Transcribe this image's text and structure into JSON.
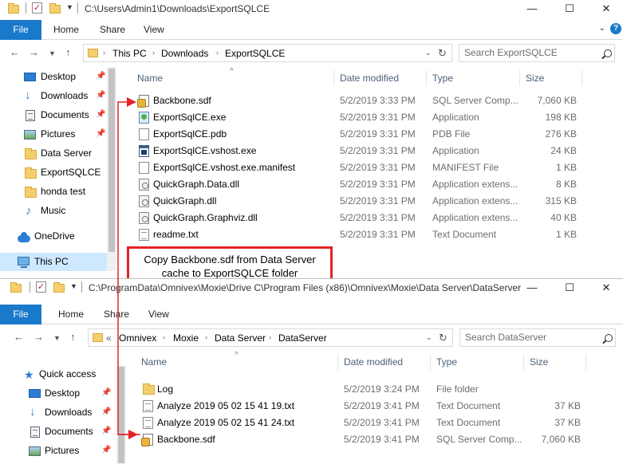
{
  "top_window": {
    "title": "C:\\Users\\Admin1\\Downloads\\ExportSQLCE",
    "ribbon_tabs": [
      "File",
      "Home",
      "Share",
      "View"
    ],
    "breadcrumb": [
      "This PC",
      "Downloads",
      "ExportSQLCE"
    ],
    "search_placeholder": "Search ExportSQLCE",
    "nav_items": [
      {
        "label": "Desktop",
        "icon": "desktop-icon",
        "pinned": true
      },
      {
        "label": "Downloads",
        "icon": "download-icon",
        "pinned": true
      },
      {
        "label": "Documents",
        "icon": "documents-icon",
        "pinned": true
      },
      {
        "label": "Pictures",
        "icon": "pictures-icon",
        "pinned": true
      },
      {
        "label": "Data Server",
        "icon": "folder-icon",
        "pinned": false
      },
      {
        "label": "ExportSQLCE",
        "icon": "folder-icon",
        "pinned": false
      },
      {
        "label": "honda test",
        "icon": "folder-icon",
        "pinned": false
      },
      {
        "label": "Music",
        "icon": "music-icon",
        "pinned": false
      },
      {
        "label": "OneDrive",
        "icon": "onedrive-icon",
        "pinned": false
      },
      {
        "label": "This PC",
        "icon": "this-pc-icon",
        "pinned": false,
        "selected": true
      }
    ],
    "columns": [
      "Name",
      "Date modified",
      "Type",
      "Size"
    ],
    "files": [
      {
        "name": "Backbone.sdf",
        "date": "5/2/2019 3:33 PM",
        "type": "SQL Server Comp...",
        "size": "7,060 KB",
        "icon": "sdf"
      },
      {
        "name": "ExportSqlCE.exe",
        "date": "5/2/2019 3:31 PM",
        "type": "Application",
        "size": "198 KB",
        "icon": "exe"
      },
      {
        "name": "ExportSqlCE.pdb",
        "date": "5/2/2019 3:31 PM",
        "type": "PDB File",
        "size": "276 KB",
        "icon": "blank"
      },
      {
        "name": "ExportSqlCE.vshost.exe",
        "date": "5/2/2019 3:31 PM",
        "type": "Application",
        "size": "24 KB",
        "icon": "app"
      },
      {
        "name": "ExportSqlCE.vshost.exe.manifest",
        "date": "5/2/2019 3:31 PM",
        "type": "MANIFEST File",
        "size": "1 KB",
        "icon": "blank"
      },
      {
        "name": "QuickGraph.Data.dll",
        "date": "5/2/2019 3:31 PM",
        "type": "Application extens...",
        "size": "8 KB",
        "icon": "dll"
      },
      {
        "name": "QuickGraph.dll",
        "date": "5/2/2019 3:31 PM",
        "type": "Application extens...",
        "size": "315 KB",
        "icon": "dll"
      },
      {
        "name": "QuickGraph.Graphviz.dll",
        "date": "5/2/2019 3:31 PM",
        "type": "Application extens...",
        "size": "40 KB",
        "icon": "dll"
      },
      {
        "name": "readme.txt",
        "date": "5/2/2019 3:31 PM",
        "type": "Text Document",
        "size": "1 KB",
        "icon": "txt"
      }
    ]
  },
  "callout": {
    "line1": "Copy Backbone.sdf from Data Server",
    "line2": "cache to ExportSQLCE folder",
    "border_color": "#e52228"
  },
  "bottom_window": {
    "title": "C:\\ProgramData\\Omnivex\\Moxie\\Drive C\\Program Files (x86)\\Omnivex\\Moxie\\Data Server\\DataServer",
    "ribbon_tabs": [
      "File",
      "Home",
      "Share",
      "View"
    ],
    "breadcrumb_overflow": "«",
    "breadcrumb": [
      "Omnivex",
      "Moxie",
      "Data Server",
      "DataServer"
    ],
    "search_placeholder": "Search DataServer",
    "nav_items": [
      {
        "label": "Quick access",
        "icon": "quick-access-icon",
        "pinned": false
      },
      {
        "label": "Desktop",
        "icon": "desktop-icon",
        "pinned": true
      },
      {
        "label": "Downloads",
        "icon": "download-icon",
        "pinned": true
      },
      {
        "label": "Documents",
        "icon": "documents-icon",
        "pinned": true
      },
      {
        "label": "Pictures",
        "icon": "pictures-icon",
        "pinned": true
      }
    ],
    "columns": [
      "Name",
      "Date modified",
      "Type",
      "Size"
    ],
    "files": [
      {
        "name": "Log",
        "date": "5/2/2019 3:24 PM",
        "type": "File folder",
        "size": "",
        "icon": "folder"
      },
      {
        "name": "Analyze 2019 05 02 15 41 19.txt",
        "date": "5/2/2019 3:41 PM",
        "type": "Text Document",
        "size": "37 KB",
        "icon": "txt"
      },
      {
        "name": "Analyze 2019 05 02 15 41 24.txt",
        "date": "5/2/2019 3:41 PM",
        "type": "Text Document",
        "size": "37 KB",
        "icon": "txt"
      },
      {
        "name": "Backbone.sdf",
        "date": "5/2/2019 3:41 PM",
        "type": "SQL Server Comp...",
        "size": "7,060 KB",
        "icon": "sdf"
      }
    ]
  },
  "colors": {
    "accent": "#1979ca",
    "selection": "#cde8ff",
    "arrow": "#e52228",
    "column_header": "#4c607a"
  }
}
